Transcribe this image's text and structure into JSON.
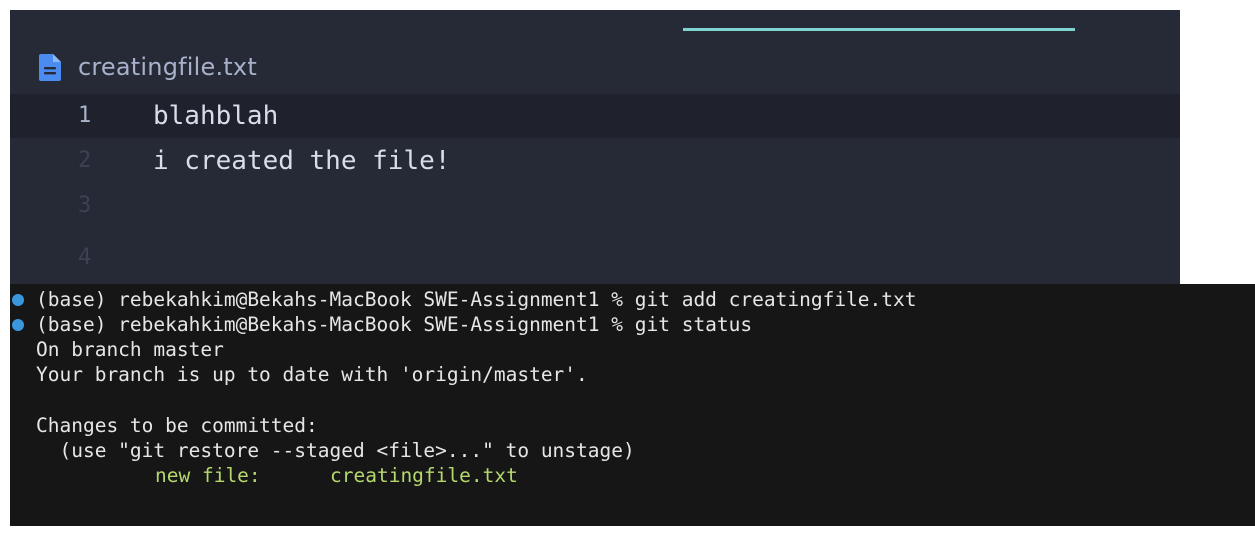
{
  "editor": {
    "tab_label": "creatingfile.txt",
    "tab_icon": "file-icon",
    "accent_color": "#7fd3d0",
    "lines": [
      {
        "number": "1",
        "text": "blahblah"
      },
      {
        "number": "2",
        "text": "i created the file!"
      },
      {
        "number": "3",
        "text": ""
      },
      {
        "number": "4",
        "text": ""
      }
    ]
  },
  "terminal": {
    "prompt_dot_color": "#3a96dd",
    "commands": [
      {
        "text": "(base) rebekahkim@Bekahs-MacBook SWE-Assignment1 % git add creatingfile.txt"
      },
      {
        "text": "(base) rebekahkim@Bekahs-MacBook SWE-Assignment1 % git status"
      }
    ],
    "output": {
      "branch": "On branch master",
      "upstream": "Your branch is up to date with 'origin/master'.",
      "changes_header": "Changes to be committed:",
      "hint": "  (use \"git restore --staged <file>...\" to unstage)",
      "new_file_label": "new file:",
      "new_file_name": "creatingfile.txt"
    }
  }
}
